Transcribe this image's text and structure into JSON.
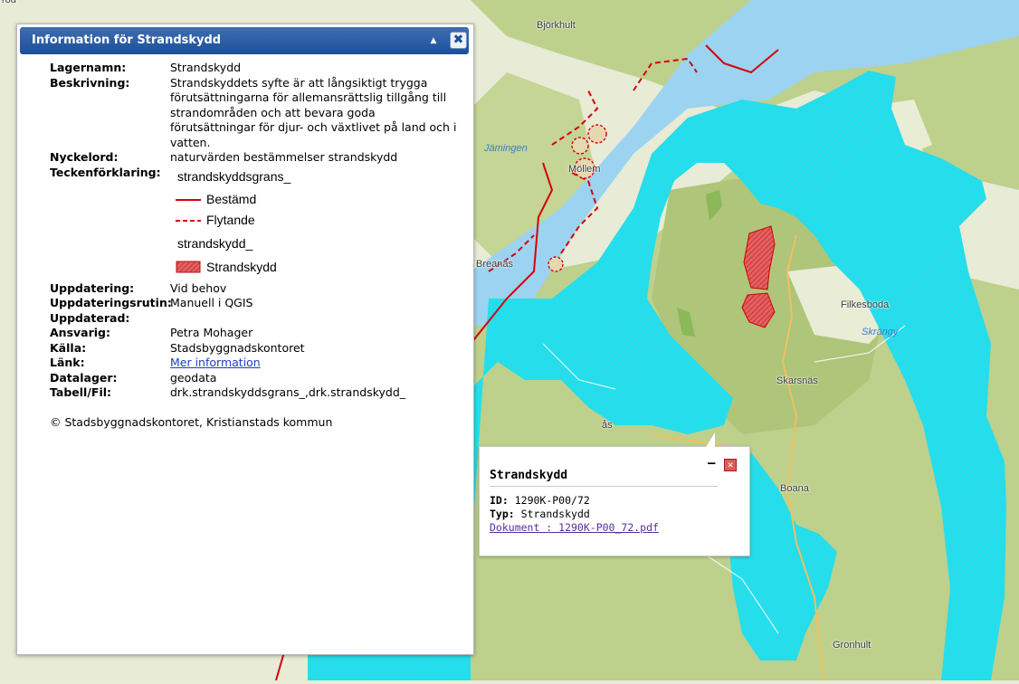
{
  "map": {
    "labels": {
      "bjorkhult": "Björkhult",
      "jamingen": "Jämingen",
      "mollem": "Möllem",
      "breanas": "Breanäs",
      "filkesboda": "Filkesboda",
      "skarsnas": "Skarsnäs",
      "skrangy": "Skrängy",
      "boana": "Boana",
      "gronhult": "Gronhult",
      "as": "ås",
      "top_left": "rod"
    },
    "colors": {
      "forest": "#bdd08c",
      "open_land": "#e8ebd6",
      "lake": "#9cd3f0",
      "strandskydd_zone": "#1fe0ee",
      "boundary_line": "#d8000a",
      "reserve_fill": "#d94040"
    }
  },
  "info_window": {
    "title": "Information för Strandskydd",
    "minimize_icon": "▲",
    "close_icon": "✖",
    "fields": {
      "lagernamn": {
        "label": "Lagernamn:",
        "value": "Strandskydd"
      },
      "beskrivning": {
        "label": "Beskrivning:",
        "value": "Strandskyddets syfte är att långsiktigt trygga förutsättningarna för allemansrättslig tillgång till strandområden och att bevara goda förutsättningar för djur- och växtlivet på land och i vatten."
      },
      "nyckelord": {
        "label": "Nyckelord:",
        "value": "naturvärden bestämmelser strandskydd"
      },
      "teckenforklaring": {
        "label": "Teckenförklaring:"
      },
      "uppdatering": {
        "label": "Uppdatering:",
        "value": "Vid behov"
      },
      "uppdateringsrutin": {
        "label": "Uppdateringsrutin:",
        "value": "Manuell i QGIS"
      },
      "uppdaterad": {
        "label": "Uppdaterad:",
        "value": ""
      },
      "ansvarig": {
        "label": "Ansvarig:",
        "value": "Petra Mohager"
      },
      "kalla": {
        "label": "Källa:",
        "value": "Stadsbyggnadskontoret"
      },
      "lank": {
        "label": "Länk:",
        "value": "Mer information"
      },
      "datalager": {
        "label": "Datalager:",
        "value": "geodata"
      },
      "tabell": {
        "label": "Tabell/Fil:",
        "value": "drk.strandskyddsgrans_,drk.strandskydd_"
      }
    },
    "legend": {
      "group1": "strandskyddsgrans_",
      "item_bestamd": "Bestämd",
      "item_flytande": "Flytande",
      "group2": "strandskydd_",
      "item_strandskydd": "Strandskydd"
    },
    "copyright": "© Stadsbyggnadskontoret, Kristianstads kommun"
  },
  "popup": {
    "title": "Strandskydd",
    "id_label": "ID:",
    "id_value": "1290K-P00/72",
    "typ_label": "Typ:",
    "typ_value": "Strandskydd",
    "doc_link": "Dokument : 1290K-P00_72.pdf",
    "minimize_icon": "–",
    "close_icon": "✕"
  }
}
